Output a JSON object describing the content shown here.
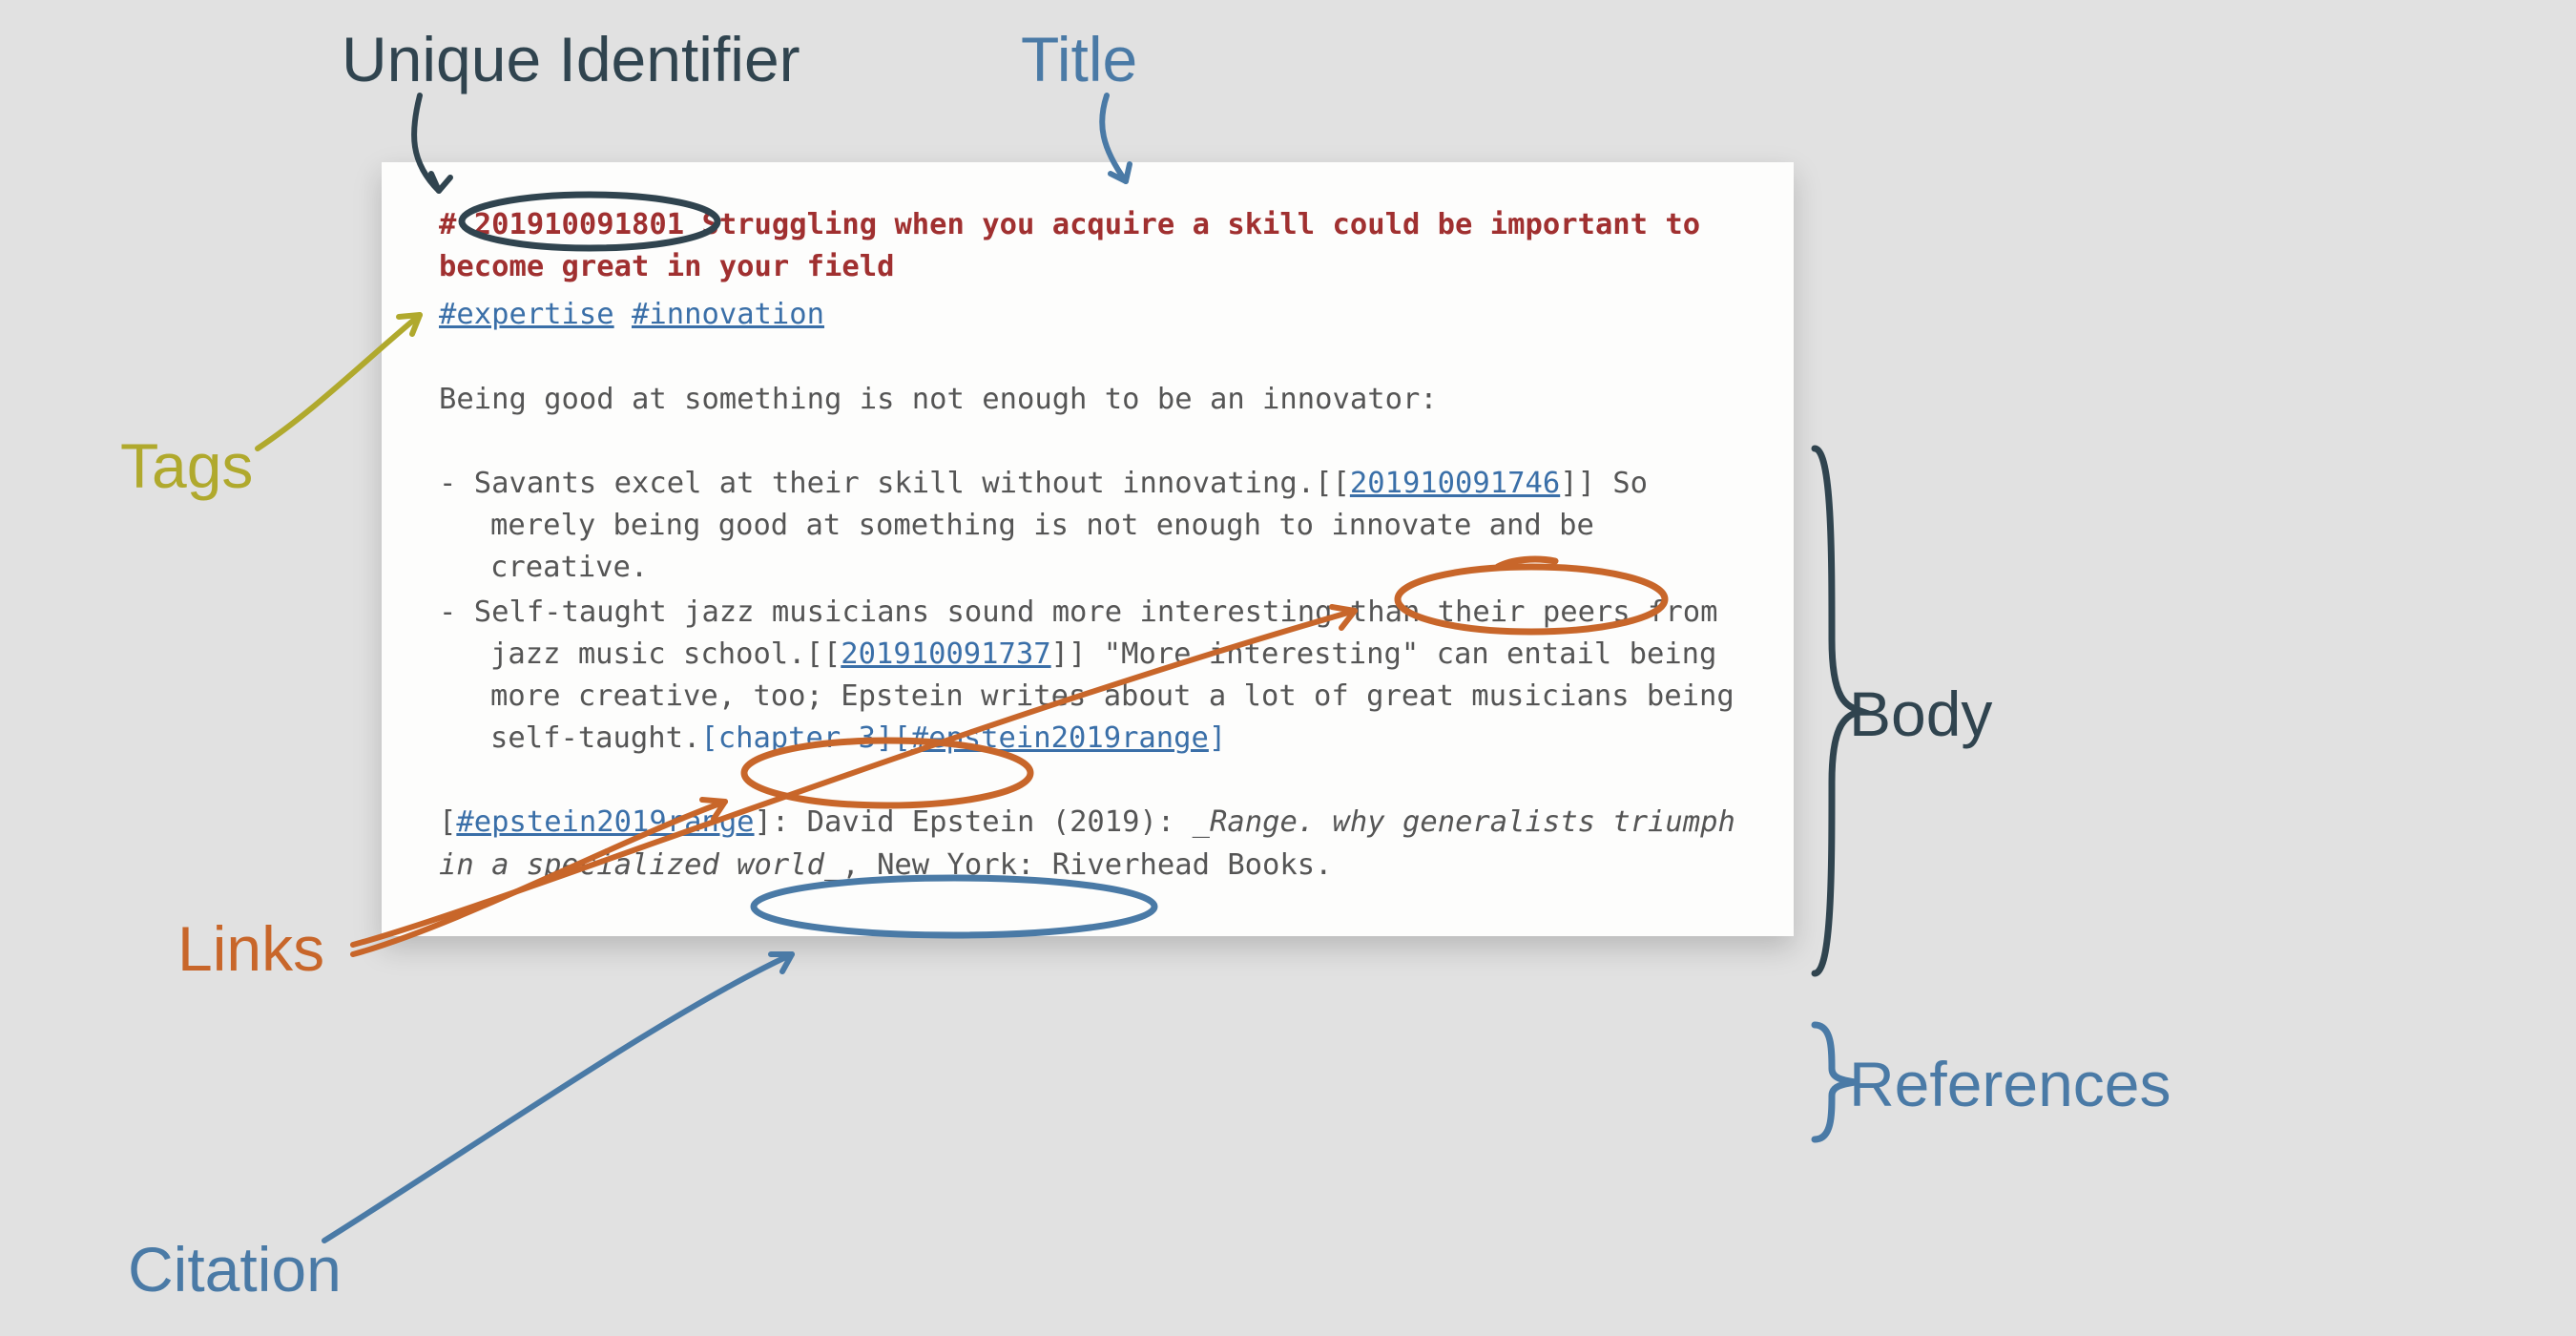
{
  "labels": {
    "uid": "Unique Identifier",
    "title": "Title",
    "tags": "Tags",
    "body": "Body",
    "links": "Links",
    "references": "References",
    "citation": "Citation"
  },
  "note": {
    "title_prefix": "# ",
    "uid": "201910091801",
    "title_rest": " Struggling when you acquire a skill could be important to become great in your field",
    "tags": {
      "tag1": "#expertise",
      "tag2": "#innovation"
    },
    "intro": "Being good at something is not enough to be an innovator:",
    "bullet1": {
      "pre": "- Savants excel at their skill without innovating.[[",
      "link": "201910091746",
      "post": "]] So merely being good at something is not enough to innovate and be creative."
    },
    "bullet2": {
      "pre": "- Self-taught jazz musicians sound more interesting than their peers from jazz music school.[[",
      "link": "201910091737",
      "post1": "]] \"More interesting\" can entail being more creative, too; Epstein writes about a lot of great musicians being self-taught.",
      "cite_open": "[chapter 3][",
      "cite_link": "#epstein2019range",
      "cite_close": "]"
    },
    "refs": {
      "open": "[",
      "key": "#epstein2019range",
      "after_key": "]: David Epstein (2019):  ",
      "italic": "_Range. why generalists triumph in a specialized world_",
      "tail": ", New York: Riverhead Books."
    }
  }
}
